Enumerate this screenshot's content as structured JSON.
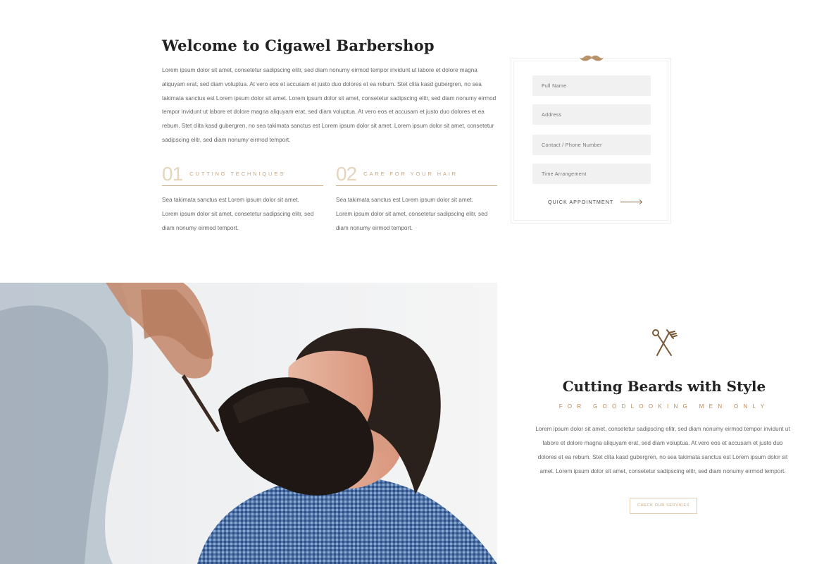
{
  "welcome": {
    "title": "Welcome to Cigawel Barbershop",
    "text": "Lorem ipsum dolor sit amet, consetetur sadipscing elitr, sed diam nonumy eirmod tempor invidunt ut labore et dolore magna aliquyam erat, sed diam voluptua. At vero eos et accusam et justo duo dolores et ea rebum. Stet clita kasd gubergren, no sea takimata sanctus est Lorem ipsum dolor sit amet. Lorem ipsum dolor sit amet, consetetur sadipscing elitr, sed diam nonumy eirmod tempor invidunt ut labore et dolore magna aliquyam erat, sed diam voluptua. At vero eos et accusam et justo duo dolores et ea rebum. Stet clita kasd gubergren, no sea takimata sanctus est Lorem ipsum dolor sit amet. Lorem ipsum dolor sit amet, consetetur sadipscing elitr, sed diam nonumy eirmod temport."
  },
  "features": [
    {
      "number": "01",
      "title": "Cutting Techniques",
      "text": "Sea takimata sanctus est Lorem ipsum dolor sit amet. Lorem ipsum dolor sit amet, consetetur sadipscing elitr, sed diam nonumy eirmod temport."
    },
    {
      "number": "02",
      "title": "Care for your hair",
      "text": "Sea takimata sanctus est Lorem ipsum dolor sit amet. Lorem ipsum dolor sit amet, consetetur sadipscing elitr, sed diam nonumy eirmod temport."
    }
  ],
  "form": {
    "mustache_icon": "mustache-icon",
    "fields": [
      {
        "placeholder": "Full Name"
      },
      {
        "placeholder": "Address"
      },
      {
        "placeholder": "Contact / Phone Number"
      },
      {
        "placeholder": "Time Arrangement"
      }
    ],
    "submit_label": "QUICK APPOINTMENT"
  },
  "beards": {
    "icon": "scissors-comb-icon",
    "title": "Cutting Beards with Style",
    "subtitle": "For goodlooking men only",
    "text": "Lorem ipsum dolor sit amet, consetetur sadipscing elitr, sed diam nonumy eirmod tempor invidunt ut labore et dolore magna aliquyam erat, sed diam voluptua. At vero eos et accusam et justo duo dolores et ea rebum. Stet clita kasd gubergren, no sea takimata sanctus est Lorem ipsum dolor sit amet. Lorem ipsum dolor sit amet, consetetur sadipscing elitr, sed diam nonumy eirmod temport.",
    "button_label": "Check our services"
  },
  "colors": {
    "accent": "#c9a77e",
    "accent_dark": "#8a6a48",
    "heading": "#222222",
    "body_text": "#666666",
    "field_bg": "#f1f1f1"
  }
}
